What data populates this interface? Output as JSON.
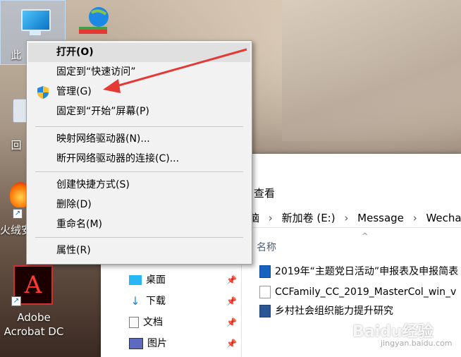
{
  "desktop": {
    "icons": [
      {
        "label": "此"
      },
      {
        "label": ""
      },
      {
        "label": "回"
      },
      {
        "label": "火绒安"
      },
      {
        "label": "Adobe Acrobat DC"
      }
    ]
  },
  "context_menu": {
    "items": [
      {
        "label": "打开(O)",
        "bold": true,
        "highlighted": true
      },
      {
        "label": "固定到“快速访问”"
      },
      {
        "label": "管理(G)",
        "icon": "shield-icon"
      },
      {
        "label": "固定到“开始”屏幕(P)"
      },
      {
        "label": "映射网络驱动器(N)..."
      },
      {
        "label": "断开网络驱动器的连接(C)..."
      },
      {
        "label": "创建快捷方式(S)"
      },
      {
        "label": "删除(D)"
      },
      {
        "label": "重命名(M)"
      },
      {
        "label": "属性(R)"
      }
    ]
  },
  "explorer": {
    "view_tab": "查看",
    "address": {
      "partial": "脑",
      "crumbs": [
        "新加卷 (E:)",
        "Message",
        "Wechat"
      ]
    },
    "nav": [
      {
        "label": "桌面",
        "icon": "desktop-folder-icon"
      },
      {
        "label": "下载",
        "icon": "download-arrow-icon"
      },
      {
        "label": "文档",
        "icon": "document-icon"
      },
      {
        "label": "图片",
        "icon": "picture-icon"
      }
    ],
    "column_name": "名称",
    "files": [
      {
        "name": "2019年“主题党日活动”申报表及申报简表",
        "icon": "zip-icon"
      },
      {
        "name": "CCFamily_CC_2019_MasterCol_win_v",
        "icon": "file-icon"
      },
      {
        "name": "乡村社会组织能力提升研究",
        "icon": "word-doc-icon"
      }
    ]
  },
  "annotation": {
    "color": "#e53935"
  },
  "watermark": {
    "text": "Baidu经验",
    "sub": "jingyan.baidu.com"
  }
}
